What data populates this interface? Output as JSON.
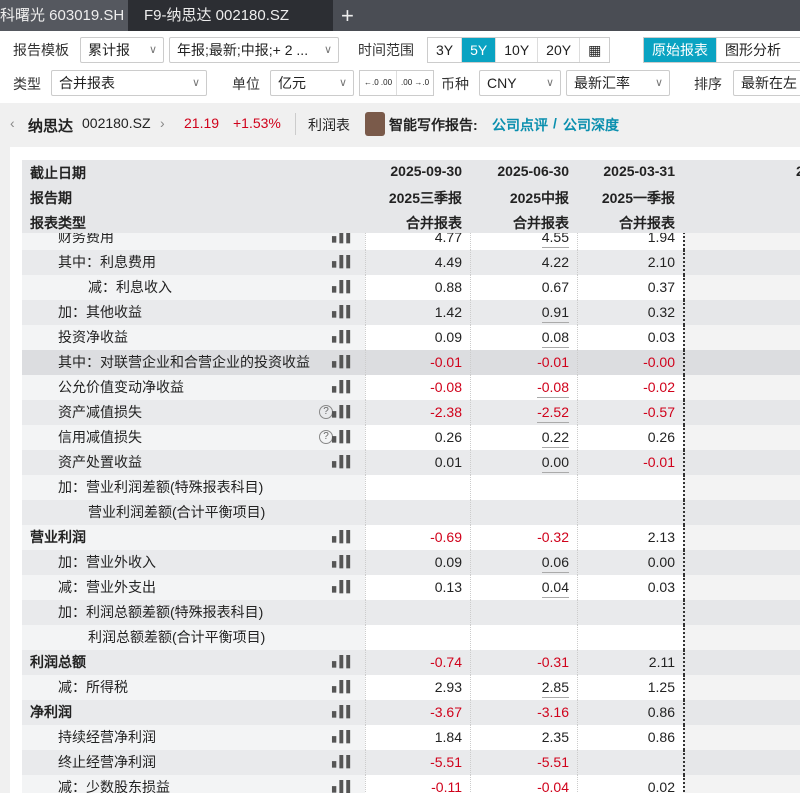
{
  "tabs": [
    "科曙光 603019.SH",
    "F9-纳思达 002180.SZ",
    "+"
  ],
  "toolbar": {
    "template_label": "报告模板",
    "template_value": "累计报",
    "period_value": "年报;最新;中报;+ 2 ...",
    "range_label": "时间范围",
    "ranges": [
      "3Y",
      "5Y",
      "10Y",
      "20Y"
    ],
    "active_range": "5Y",
    "view_modes": [
      "原始报表",
      "图形分析"
    ],
    "type_label": "类型",
    "type_value": "合并报表",
    "unit_label": "单位",
    "unit_value": "亿元",
    "dec_more": "←.0 .00",
    "dec_less": ".00 →.0",
    "currency_label": "币种",
    "currency_value": "CNY",
    "rate_value": "最新汇率",
    "sort_label": "排序",
    "sort_value": "最新在左"
  },
  "stock": {
    "name": "纳思达",
    "code": "002180.SZ",
    "price": "21.19",
    "change": "+1.53%",
    "sheet": "利润表",
    "ai_label": "智能写作报告:",
    "link1": "公司点评",
    "sep": "/",
    "link2": "公司深度"
  },
  "header": {
    "labels": [
      "截止日期",
      "报告期",
      "报表类型"
    ],
    "columns": [
      {
        "date": "2025-09-30",
        "period": "2025三季报",
        "type": "合并报表"
      },
      {
        "date": "2025-06-30",
        "period": "2025中报",
        "type": "合并报表"
      },
      {
        "date": "2025-03-31",
        "period": "2025一季报",
        "type": "合并报表"
      }
    ],
    "col4_partial": "2"
  },
  "rows": [
    {
      "label": "财务费用",
      "indent": 1,
      "values": [
        "4.77",
        "4.55",
        "1.94"
      ]
    },
    {
      "label": "其中：利息费用",
      "indent": 1,
      "values": [
        "4.49",
        "4.22",
        "2.10"
      ]
    },
    {
      "label": "减：利息收入",
      "indent": 2,
      "values": [
        "0.88",
        "0.67",
        "0.37"
      ]
    },
    {
      "label": "加：其他收益",
      "indent": 1,
      "values": [
        "1.42",
        "0.91",
        "0.32"
      ]
    },
    {
      "label": "投资净收益",
      "indent": 1,
      "values": [
        "0.09",
        "0.08",
        "0.03"
      ]
    },
    {
      "label": "其中：对联营企业和合营企业的投资收益",
      "indent": 1,
      "values": [
        "-0.01",
        "-0.01",
        "-0.00"
      ],
      "highlight": true
    },
    {
      "label": "公允价值变动净收益",
      "indent": 1,
      "values": [
        "-0.08",
        "-0.08",
        "-0.02"
      ]
    },
    {
      "label": "资产减值损失",
      "indent": 1,
      "values": [
        "-2.38",
        "-2.52",
        "-0.57"
      ],
      "help": true
    },
    {
      "label": "信用减值损失",
      "indent": 1,
      "values": [
        "0.26",
        "0.22",
        "0.26"
      ],
      "help": true
    },
    {
      "label": "资产处置收益",
      "indent": 1,
      "values": [
        "0.01",
        "0.00",
        "-0.01"
      ]
    },
    {
      "label": "加：营业利润差额(特殊报表科目)",
      "indent": 1,
      "values": [
        "",
        "",
        ""
      ],
      "nochart": true
    },
    {
      "label": "营业利润差额(合计平衡项目)",
      "indent": 2,
      "values": [
        "",
        "",
        ""
      ],
      "nochart": true
    },
    {
      "label": "营业利润",
      "indent": 0,
      "bold": true,
      "values": [
        "-0.69",
        "-0.32",
        "2.13"
      ]
    },
    {
      "label": "加：营业外收入",
      "indent": 1,
      "values": [
        "0.09",
        "0.06",
        "0.00"
      ]
    },
    {
      "label": "减：营业外支出",
      "indent": 1,
      "values": [
        "0.13",
        "0.04",
        "0.03"
      ]
    },
    {
      "label": "加：利润总额差额(特殊报表科目)",
      "indent": 1,
      "values": [
        "",
        "",
        ""
      ],
      "nochart": true
    },
    {
      "label": "利润总额差额(合计平衡项目)",
      "indent": 2,
      "values": [
        "",
        "",
        ""
      ],
      "nochart": true
    },
    {
      "label": "利润总额",
      "indent": 0,
      "bold": true,
      "values": [
        "-0.74",
        "-0.31",
        "2.11"
      ]
    },
    {
      "label": "减：所得税",
      "indent": 1,
      "values": [
        "2.93",
        "2.85",
        "1.25"
      ]
    },
    {
      "label": "净利润",
      "indent": 0,
      "bold": true,
      "values": [
        "-3.67",
        "-3.16",
        "0.86"
      ]
    },
    {
      "label": "持续经营净利润",
      "indent": 1,
      "values": [
        "1.84",
        "2.35",
        "0.86"
      ]
    },
    {
      "label": "终止经营净利润",
      "indent": 1,
      "values": [
        "-5.51",
        "-5.51",
        ""
      ]
    },
    {
      "label": "减：少数股东损益",
      "indent": 1,
      "values": [
        "-0.11",
        "-0.04",
        "0.02"
      ]
    }
  ]
}
